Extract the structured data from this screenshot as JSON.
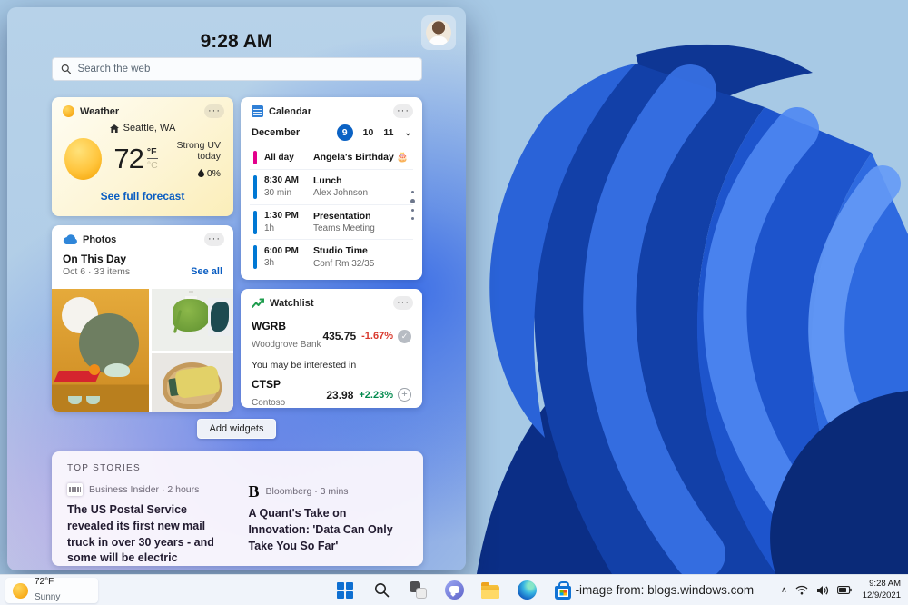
{
  "panel": {
    "time": "9:28 AM",
    "search_placeholder": "Search the web",
    "add_widgets_label": "Add widgets"
  },
  "icons": {
    "menu": "···",
    "check": "✓",
    "plus": "+",
    "chevron_down": "⌄",
    "chevron_up": "∧",
    "bloomberg_logo": "B"
  },
  "weather": {
    "title": "Weather",
    "location": "Seattle, WA",
    "temp": "72",
    "unit_f": "°F",
    "unit_c": "°C",
    "condition": "Strong UV today",
    "precipitation": "0%",
    "link": "See full forecast"
  },
  "calendar": {
    "title": "Calendar",
    "month": "December",
    "dates": [
      "9",
      "10",
      "11"
    ],
    "events": [
      {
        "time": "All day",
        "duration": "",
        "title": "Angela's Birthday 🎂",
        "subtitle": "",
        "color": "#e3008c"
      },
      {
        "time": "8:30 AM",
        "duration": "30 min",
        "title": "Lunch",
        "subtitle": "Alex Johnson",
        "color": "#0078d4"
      },
      {
        "time": "1:30 PM",
        "duration": "1h",
        "title": "Presentation",
        "subtitle": "Teams Meeting",
        "color": "#0078d4"
      },
      {
        "time": "6:00 PM",
        "duration": "3h",
        "title": "Studio Time",
        "subtitle": "Conf Rm 32/35",
        "color": "#0078d4"
      }
    ]
  },
  "photos": {
    "title": "Photos",
    "heading": "On This Day",
    "subheading": "Oct 6 · 33 items",
    "link": "See all"
  },
  "watchlist": {
    "title": "Watchlist",
    "suggestion_label": "You may be interested in",
    "stocks": [
      {
        "symbol": "WGRB",
        "name": "Woodgrove Bank",
        "price": "435.75",
        "change": "-1.67%",
        "direction": "down"
      },
      {
        "symbol": "CTSP",
        "name": "Contoso",
        "price": "23.98",
        "change": "+2.23%",
        "direction": "up"
      }
    ],
    "colors": {
      "down": "#d8382c",
      "up": "#00894c"
    }
  },
  "top_stories": {
    "heading": "TOP STORIES",
    "stories": [
      {
        "source_line": "Business Insider · 2 hours",
        "headline": "The US Postal Service revealed its first new mail truck in over 30 years - and some will be electric"
      },
      {
        "source_line": "Bloomberg · 3 mins",
        "headline": "A Quant's Take on Innovation: 'Data Can Only Take You So Far'"
      }
    ]
  },
  "taskbar": {
    "weather_temp": "72°F",
    "weather_condition": "Sunny",
    "credit": "-image from: blogs.windows.com",
    "clock_time": "9:28 AM",
    "clock_date": "12/9/2021"
  }
}
